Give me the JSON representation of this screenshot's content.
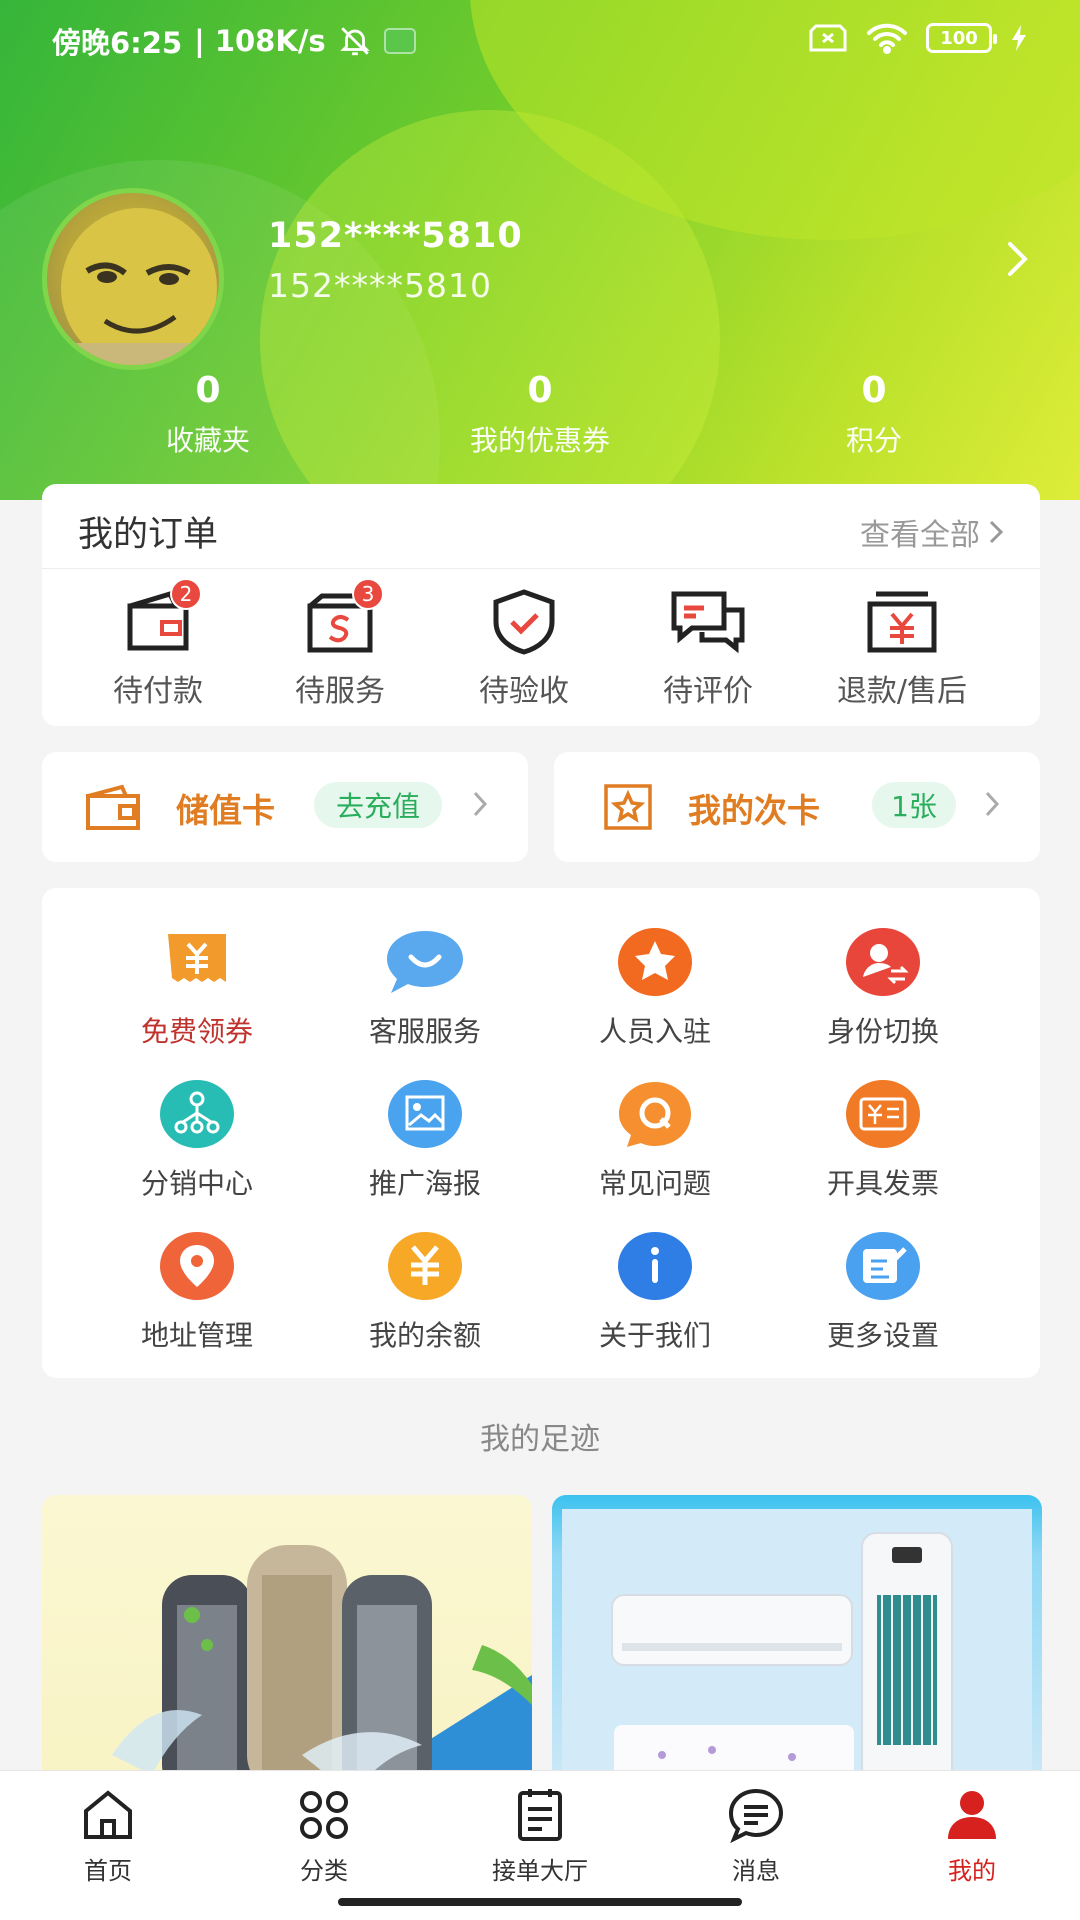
{
  "status_bar": {
    "time": "傍晚6:25",
    "network_speed": "| 108K/s",
    "battery": "100"
  },
  "profile": {
    "name": "152****5810",
    "sub": "152****5810"
  },
  "stats": [
    {
      "value": "0",
      "label": "收藏夹"
    },
    {
      "value": "0",
      "label": "我的优惠券"
    },
    {
      "value": "0",
      "label": "积分"
    }
  ],
  "orders": {
    "title": "我的订单",
    "view_all": "查看全部",
    "items": [
      {
        "label": "待付款",
        "badge": "2",
        "icon": "wallet-icon"
      },
      {
        "label": "待服务",
        "badge": "3",
        "icon": "service-icon"
      },
      {
        "label": "待验收",
        "badge": "",
        "icon": "shield-check-icon"
      },
      {
        "label": "待评价",
        "badge": "",
        "icon": "comment-icon"
      },
      {
        "label": "退款/售后",
        "badge": "",
        "icon": "refund-icon"
      }
    ]
  },
  "stored_card": {
    "label": "储值卡",
    "action": "去充值"
  },
  "times_card": {
    "label": "我的次卡",
    "count": "1张"
  },
  "services": [
    {
      "label": "免费领券",
      "icon": "coupon-icon",
      "color": "#f29a2b"
    },
    {
      "label": "客服服务",
      "icon": "chat-icon",
      "color": "#5aa9ef"
    },
    {
      "label": "人员入驻",
      "icon": "star-icon",
      "color": "#f26a1f"
    },
    {
      "label": "身份切换",
      "icon": "user-switch-icon",
      "color": "#e8463a"
    },
    {
      "label": "分销中心",
      "icon": "network-icon",
      "color": "#27bcb4"
    },
    {
      "label": "推广海报",
      "icon": "image-icon",
      "color": "#4aa3ee"
    },
    {
      "label": "常见问题",
      "icon": "question-icon",
      "color": "#f58f2f"
    },
    {
      "label": "开具发票",
      "icon": "invoice-icon",
      "color": "#f07a26"
    },
    {
      "label": "地址管理",
      "icon": "location-icon",
      "color": "#f0643a"
    },
    {
      "label": "我的余额",
      "icon": "yuan-icon",
      "color": "#f6a826"
    },
    {
      "label": "关于我们",
      "icon": "info-icon",
      "color": "#2f7ee6"
    },
    {
      "label": "更多设置",
      "icon": "edit-icon",
      "color": "#4aa1ef"
    }
  ],
  "footprint_title": "我的足迹",
  "tabs": [
    {
      "label": "首页",
      "icon": "home-icon"
    },
    {
      "label": "分类",
      "icon": "category-icon"
    },
    {
      "label": "接单大厅",
      "icon": "order-hall-icon"
    },
    {
      "label": "消息",
      "icon": "message-icon"
    },
    {
      "label": "我的",
      "icon": "profile-icon",
      "active": true
    }
  ],
  "colors": {
    "accent_red": "#d6211e",
    "orange": "#e07c22",
    "green": "#2bae5c"
  }
}
